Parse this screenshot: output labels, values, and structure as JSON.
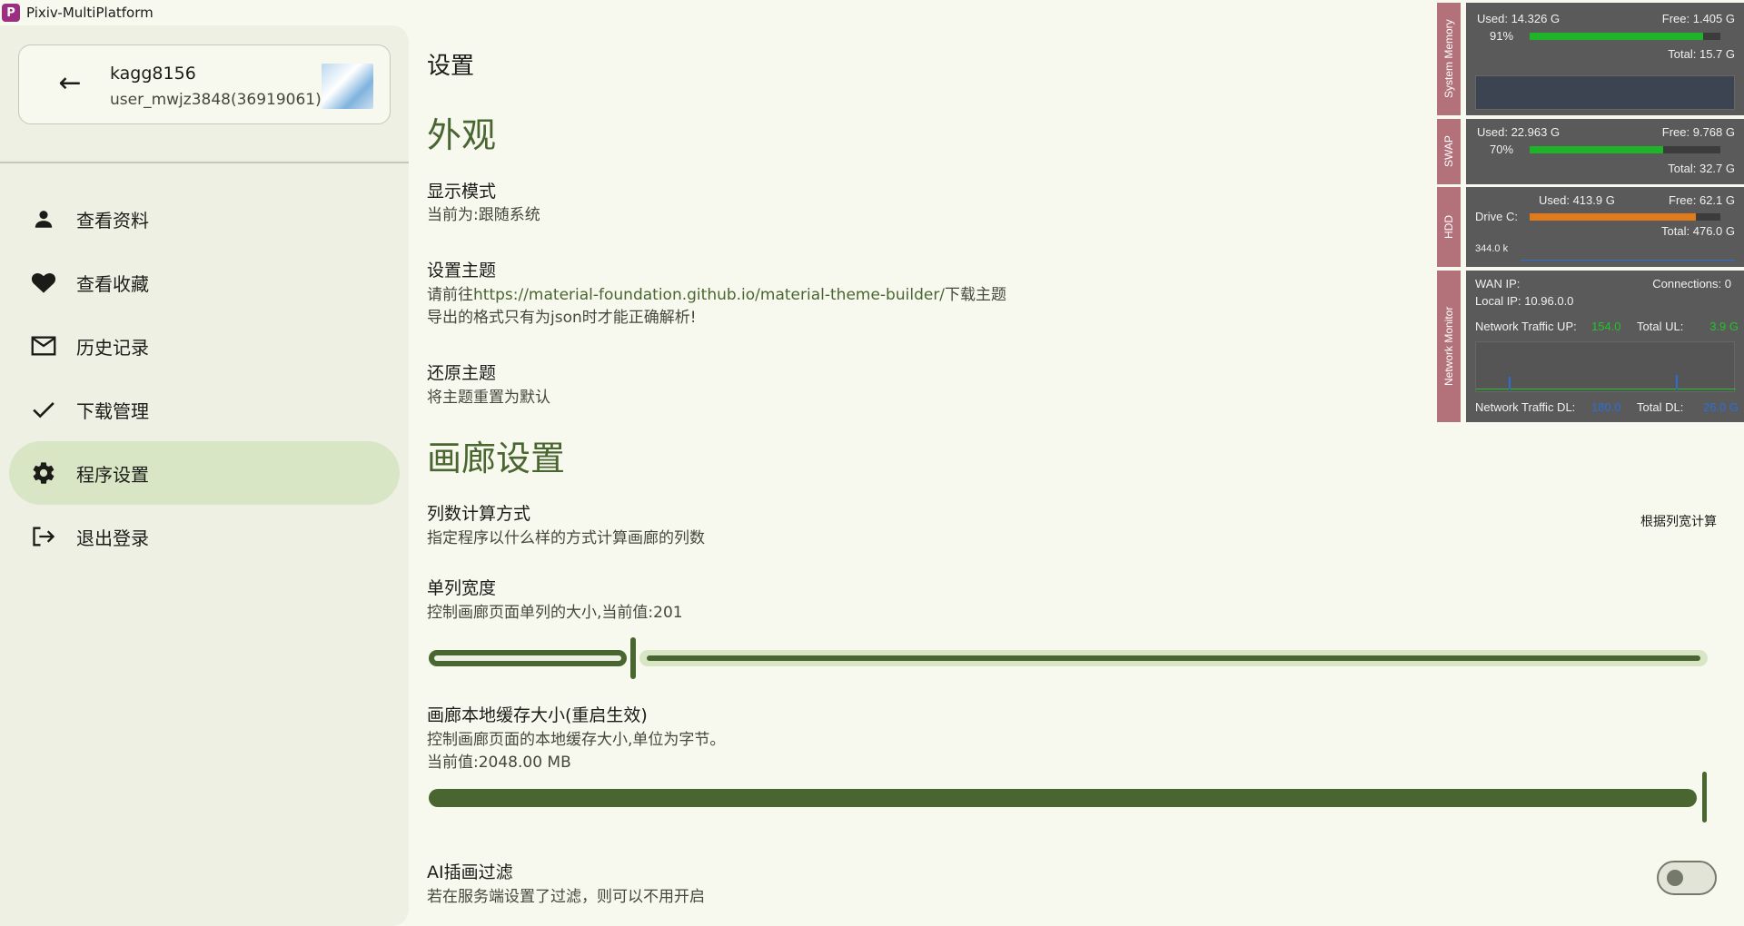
{
  "window": {
    "app_icon_text": "P",
    "title": "Pixiv-MultiPlatform",
    "minimize": "—",
    "maximize": "▢",
    "close": "✕"
  },
  "sidebar": {
    "user": {
      "name": "kagg8156",
      "id_text": "user_mwjz3848(36919061)"
    },
    "items": [
      {
        "label": "查看资料",
        "icon": "person-icon"
      },
      {
        "label": "查看收藏",
        "icon": "heart-icon"
      },
      {
        "label": "历史记录",
        "icon": "mail-icon"
      },
      {
        "label": "下载管理",
        "icon": "check-icon"
      },
      {
        "label": "程序设置",
        "icon": "gear-icon",
        "active": true
      },
      {
        "label": "退出登录",
        "icon": "logout-icon"
      }
    ]
  },
  "main": {
    "title": "设置",
    "appearance": {
      "section": "外观",
      "display_mode": {
        "title": "显示模式",
        "desc": "当前为:跟随系统"
      },
      "theme": {
        "title": "设置主题",
        "desc_prefix": "请前往",
        "link": "https://material-foundation.github.io/material-theme-builder/",
        "desc_suffix": "下载主题",
        "desc_line2": "导出的格式只有为json时才能正确解析!"
      },
      "reset": {
        "title": "还原主题",
        "desc": "将主题重置为默认"
      }
    },
    "gallery": {
      "section": "画廊设置",
      "column_mode": {
        "title": "列数计算方式",
        "desc": "指定程序以什么样的方式计算画廊的列数",
        "value": "根据列宽计算"
      },
      "column_width": {
        "title": "单列宽度",
        "desc": "控制画廊页面单列的大小,当前值:201",
        "slider_fraction": 0.16
      },
      "cache_size": {
        "title": "画廊本地缓存大小(重启生效)",
        "desc": "控制画廊页面的本地缓存大小,单位为字节。",
        "desc_line2": "当前值:2048.00 MB",
        "slider_fraction": 1.0
      },
      "ai_filter": {
        "title": "AI插画过滤",
        "desc": "若在服务端设置了过滤，则可以不用开启",
        "enabled": false
      }
    }
  },
  "monitor": {
    "memory": {
      "tab": "System Memory",
      "used": "Used: 14.326 G",
      "free": "Free: 1.405 G",
      "percent": "91%",
      "total": "Total: 15.7 G",
      "fill": 0.91,
      "color": "#1fb32a"
    },
    "swap": {
      "tab": "SWAP",
      "used": "Used: 22.963 G",
      "free": "Free: 9.768 G",
      "percent": "70%",
      "total": "Total: 32.7 G",
      "fill": 0.7,
      "color": "#1fb32a"
    },
    "hdd": {
      "tab": "HDD",
      "drive": "Drive C:",
      "used": "Used: 413.9 G",
      "free": "Free: 62.1 G",
      "total": "Total: 476.0 G",
      "rate": "344.0 k",
      "fill": 0.87,
      "color": "#e07a1a"
    },
    "network": {
      "tab": "Network Monitor",
      "wan": "WAN IP:",
      "connections": "Connections: 0",
      "local": "Local IP: 10.96.0.0",
      "up_label": "Network Traffic UP:",
      "up_value": "154.0",
      "total_ul_label": "Total UL:",
      "total_ul_value": "3.9 G",
      "dl_label": "Network Traffic DL:",
      "dl_value": "180.0",
      "total_dl_label": "Total DL:",
      "total_dl_value": "26.0 G",
      "up_color": "#22c22a",
      "dl_color": "#2a6fd8"
    }
  }
}
